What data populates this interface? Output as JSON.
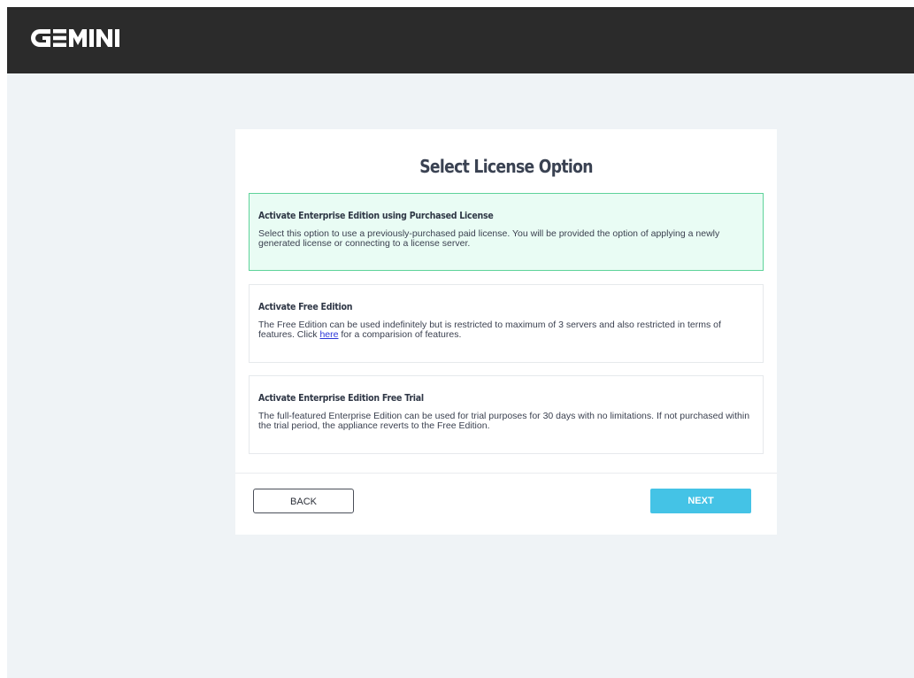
{
  "header": {
    "logo_text": "GEMINI"
  },
  "page": {
    "title": "Select License Option"
  },
  "options": [
    {
      "title": "Activate Enterprise Edition using Purchased License",
      "description": "Select this option to use a previously-purchased paid license. You will be provided the option of applying a newly generated license or connecting to a license server.",
      "selected": true
    },
    {
      "title": "Activate Free Edition",
      "description_before_link": "The Free Edition can be used indefinitely but is restricted to maximum of 3 servers and also restricted in terms of features. Click ",
      "link_text": "here",
      "description_after_link": " for a comparision of features.",
      "selected": false
    },
    {
      "title": "Activate Enterprise Edition Free Trial",
      "description": "The full-featured Enterprise Edition can be used for trial purposes for 30 days with no limitations. If not purchased within the trial period, the appliance reverts to the Free Edition.",
      "selected": false
    }
  ],
  "footer": {
    "back_label": "BACK",
    "next_label": "NEXT"
  },
  "colors": {
    "topbar": "#2b2b2b",
    "page_background": "#eff3f6",
    "selected_border": "#5ed39a",
    "selected_background": "#e9fcf4",
    "next_button": "#44c3e6",
    "link": "#2a35d8"
  }
}
